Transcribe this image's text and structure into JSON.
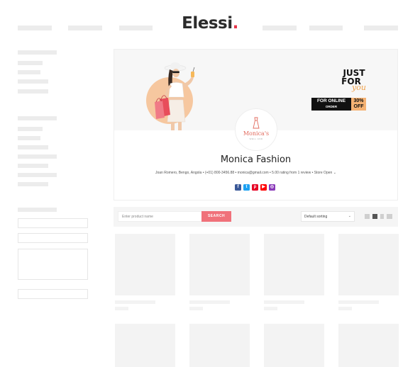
{
  "logo": {
    "text": "Elessi",
    "dot": "."
  },
  "store": {
    "avatar_name": "Monica's",
    "avatar_sub": "WELL AND",
    "name": "Monica Fashion",
    "info": "Joan Romero, Bengo, Angola • (+01) 800-3456.88 • monica@gmail.com • 5.00 rating from 1 review • Store Open",
    "info_chevron": "⌄",
    "promo": {
      "just": "JUST",
      "for": "FOR",
      "you": "you",
      "online": "FOR ONLINE",
      "order": "ORDER",
      "percent": "30%",
      "off": "OFF"
    },
    "socials": [
      {
        "icon": "facebook-icon",
        "glyph": "f",
        "color": "#3b5998"
      },
      {
        "icon": "twitter-icon",
        "glyph": "t",
        "color": "#1da1f2"
      },
      {
        "icon": "pinterest-icon",
        "glyph": "p",
        "color": "#e60023"
      },
      {
        "icon": "youtube-icon",
        "glyph": "▶",
        "color": "#ff0000"
      },
      {
        "icon": "instagram-icon",
        "glyph": "◎",
        "color": "#8a3ab9"
      }
    ]
  },
  "toolbar": {
    "search_placeholder": "Enter product name",
    "search_button": "SEARCH",
    "sort_value": "Default sorting",
    "sort_chevron": "⌄"
  },
  "colors": {
    "accent": "#f0717a",
    "logo_dot": "#e5354a",
    "promo_orange": "#f5b273"
  }
}
